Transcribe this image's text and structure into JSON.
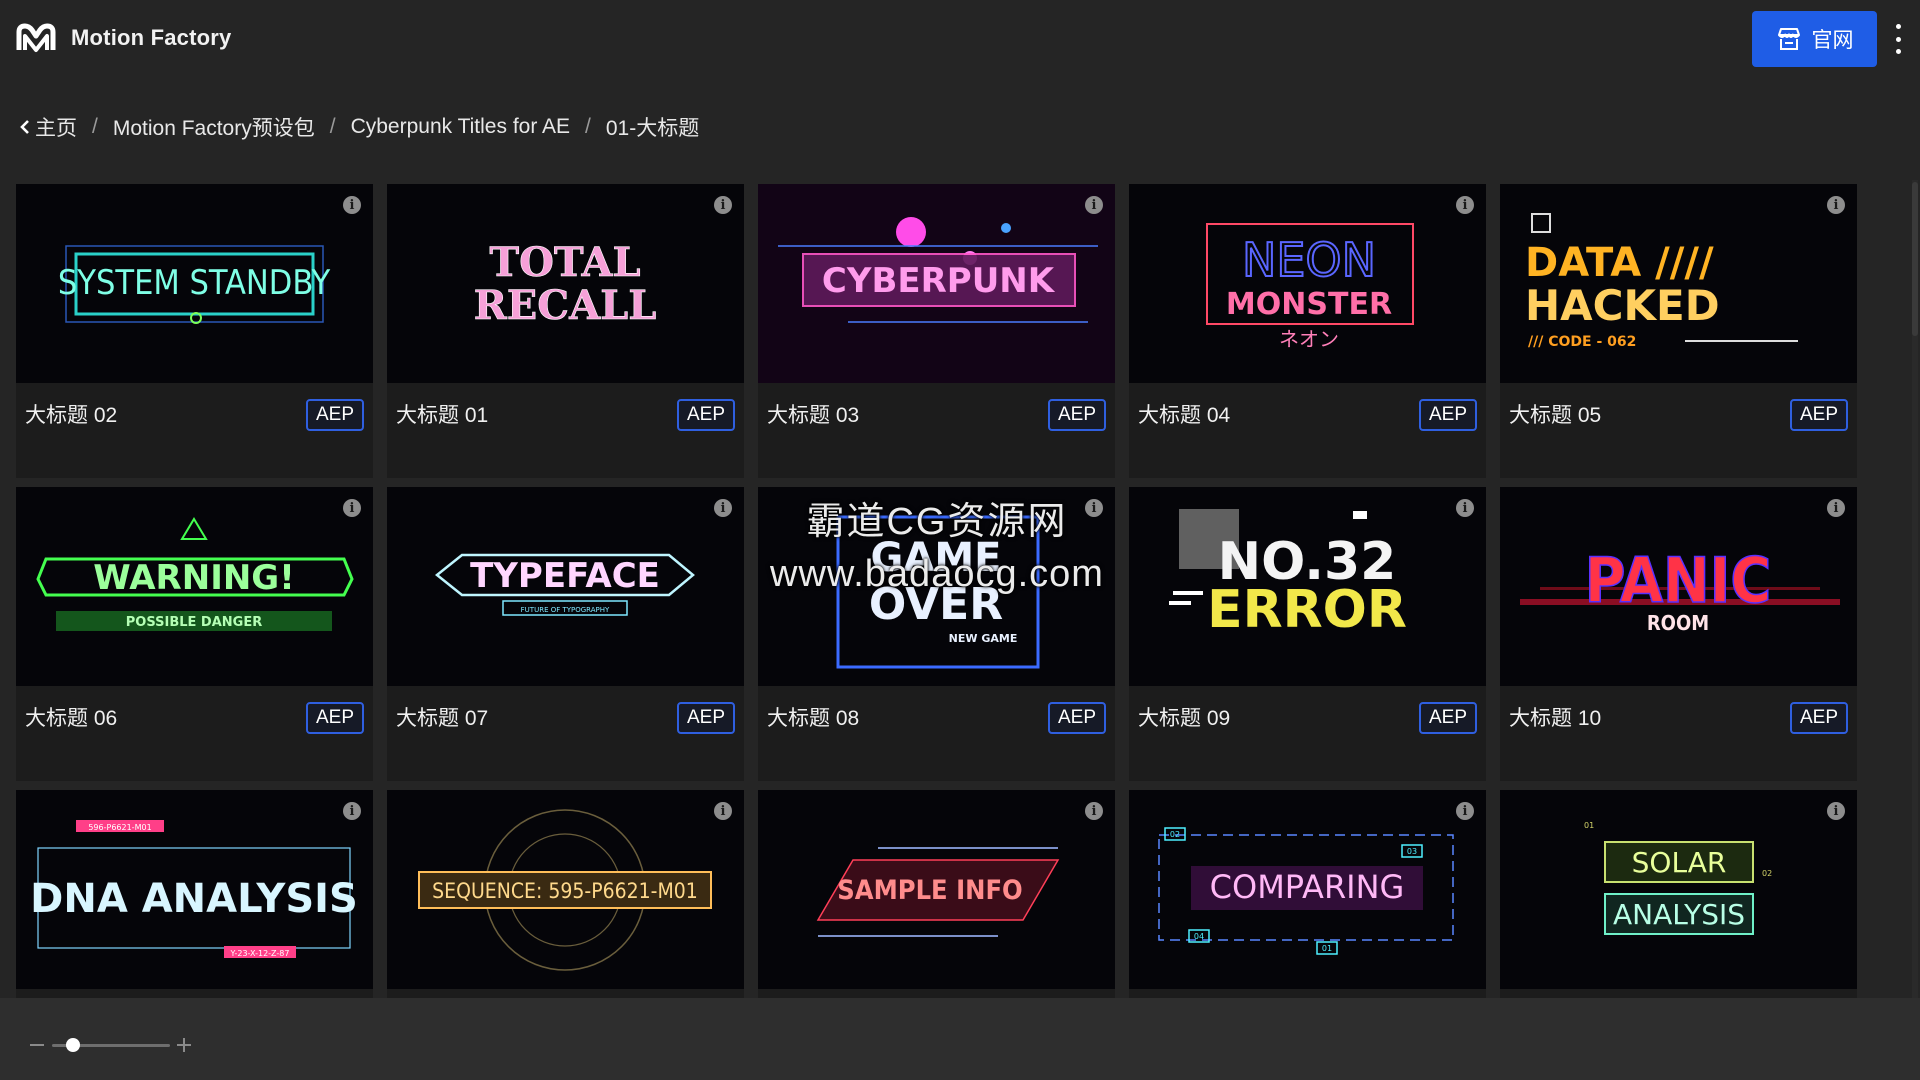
{
  "app": {
    "title": "Motion Factory",
    "logo_icon": "motion-factory-logo-icon"
  },
  "header": {
    "site_button_label": "官网",
    "site_button_icon": "store-icon",
    "menu_icon": "kebab-menu-icon",
    "accent": "#1f5de6"
  },
  "breadcrumb": {
    "items": [
      "主页",
      "Motion Factory预设包",
      "Cyberpunk Titles for AE",
      "01-大标题"
    ],
    "separator": "/"
  },
  "cards": [
    {
      "title": "大标题 02",
      "badge": "AEP",
      "preview": [
        "SYSTEM STANDBY"
      ]
    },
    {
      "title": "大标题 01",
      "badge": "AEP",
      "preview": [
        "TOTAL",
        "RECALL"
      ]
    },
    {
      "title": "大标题 03",
      "badge": "AEP",
      "preview": [
        "CYBERPUNK"
      ]
    },
    {
      "title": "大标题 04",
      "badge": "AEP",
      "preview": [
        "NEON",
        "MONSTER",
        "ネオン"
      ]
    },
    {
      "title": "大标题 05",
      "badge": "AEP",
      "preview": [
        "DATA ////",
        "HACKED",
        "/// CODE - 062"
      ]
    },
    {
      "title": "大标题 06",
      "badge": "AEP",
      "preview": [
        "WARNING!",
        "POSSIBLE DANGER"
      ]
    },
    {
      "title": "大标题 07",
      "badge": "AEP",
      "preview": [
        "TYPEFACE",
        "FUTURE OF TYPOGRAPHY"
      ]
    },
    {
      "title": "大标题 08",
      "badge": "AEP",
      "preview": [
        "GAME",
        "OVER",
        "NEW GAME"
      ]
    },
    {
      "title": "大标题 09",
      "badge": "AEP",
      "preview": [
        "NO.32",
        "ERROR"
      ]
    },
    {
      "title": "大标题 10",
      "badge": "AEP",
      "preview": [
        "PANIC",
        "ROOM"
      ]
    },
    {
      "title": "",
      "badge": "",
      "preview": [
        "DNA ANALYSIS",
        "596-P6621-M01",
        "Y-23-X-12-Z-87"
      ]
    },
    {
      "title": "",
      "badge": "",
      "preview": [
        "SEQUENCE: 595-P6621-M01"
      ]
    },
    {
      "title": "",
      "badge": "",
      "preview": [
        "SAMPLE INFO"
      ]
    },
    {
      "title": "",
      "badge": "",
      "preview": [
        "COMPARING",
        "02",
        "03",
        "04",
        "01"
      ]
    },
    {
      "title": "",
      "badge": "",
      "preview": [
        "SOLAR",
        "ANALYSIS",
        "01",
        "02"
      ]
    }
  ],
  "watermark": {
    "line1": "霸道CG资源网",
    "line2": "www.badaocg.com"
  },
  "footer": {
    "zoom_level_fraction": 0.18
  }
}
